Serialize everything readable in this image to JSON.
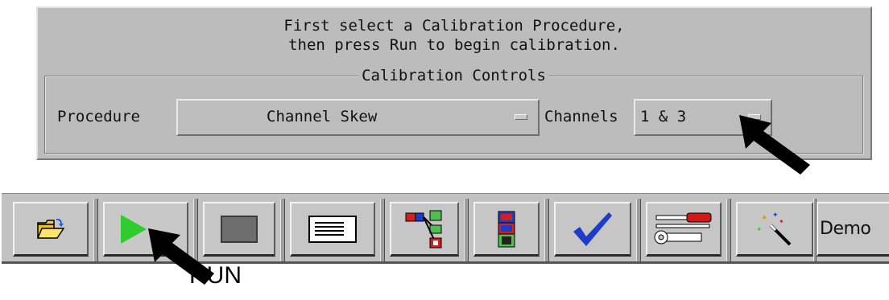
{
  "panel": {
    "instructions": [
      "First select a Calibration Procedure,",
      "then press Run to begin calibration."
    ],
    "group_title": "Calibration Controls",
    "procedure_label": "Procedure",
    "procedure_value": "Channel Skew",
    "channels_label": "Channels",
    "channels_value": "1 & 3"
  },
  "toolbar": {
    "buttons": [
      {
        "name": "open-folder",
        "icon": "folder-open-icon"
      },
      {
        "name": "run",
        "icon": "play-icon",
        "color": "#2fcc2f"
      },
      {
        "name": "stop",
        "icon": "stop-square-icon",
        "color": "#6e6e6e"
      },
      {
        "name": "listing",
        "icon": "list-document-icon"
      },
      {
        "name": "system-overview",
        "icon": "network-tree-icon"
      },
      {
        "name": "module-setup",
        "icon": "module-stack-icon"
      },
      {
        "name": "calibration",
        "icon": "checkmark-icon",
        "color": "#1f3cc8"
      },
      {
        "name": "tools",
        "icon": "wrench-screwdriver-icon",
        "color": "#d01818"
      },
      {
        "name": "wizard",
        "icon": "magic-wand-icon"
      },
      {
        "name": "demo",
        "icon": "demo-icon",
        "label": "Demo"
      }
    ]
  },
  "annotations": {
    "run_label": "RUN"
  }
}
